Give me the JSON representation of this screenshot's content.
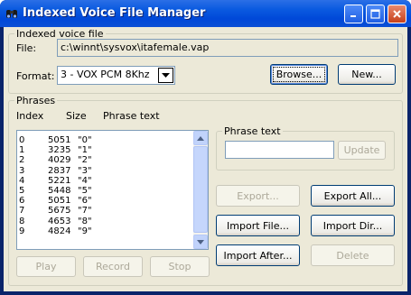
{
  "window": {
    "title": "Indexed Voice File Manager",
    "app_icon": "binoculars-icon",
    "controls": [
      "minimize-icon",
      "maximize-icon",
      "close-icon"
    ]
  },
  "indexed_file": {
    "group_label": "Indexed voice file",
    "file_label": "File:",
    "file_value": "c:\\winnt\\sysvox\\itafemale.vap",
    "format_label": "Format:",
    "format_value": "3 - VOX PCM 8Khz",
    "browse_label": "Browse...",
    "new_label": "New..."
  },
  "phrases": {
    "group_label": "Phrases",
    "columns": [
      "Index",
      "Size",
      "Phrase text"
    ],
    "rows": [
      {
        "index": "0",
        "size": "5051",
        "text": "\"0\""
      },
      {
        "index": "1",
        "size": "3235",
        "text": "\"1\""
      },
      {
        "index": "2",
        "size": "4029",
        "text": "\"2\""
      },
      {
        "index": "3",
        "size": "2837",
        "text": "\"3\""
      },
      {
        "index": "4",
        "size": "5221",
        "text": "\"4\""
      },
      {
        "index": "5",
        "size": "5448",
        "text": "\"5\""
      },
      {
        "index": "6",
        "size": "5051",
        "text": "\"6\""
      },
      {
        "index": "7",
        "size": "5675",
        "text": "\"7\""
      },
      {
        "index": "8",
        "size": "4653",
        "text": "\"8\""
      },
      {
        "index": "9",
        "size": "4824",
        "text": "\"9\""
      }
    ],
    "phrase_text_group": "Phrase text",
    "phrase_text_value": "",
    "update_label": "Update",
    "export_label": "Export...",
    "export_all_label": "Export All...",
    "import_file_label": "Import File...",
    "import_dir_label": "Import Dir...",
    "import_after_label": "Import After...",
    "delete_label": "Delete",
    "play_label": "Play",
    "record_label": "Record",
    "stop_label": "Stop"
  }
}
